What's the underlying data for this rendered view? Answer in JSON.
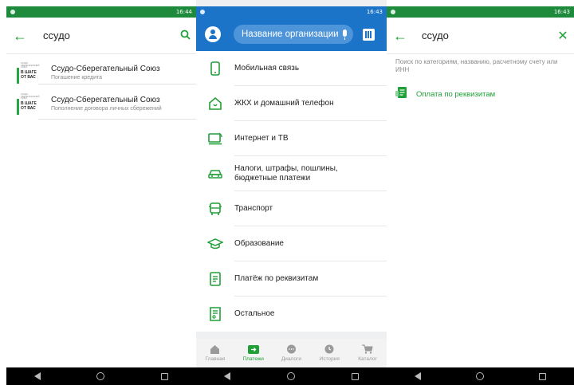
{
  "status": {
    "left_time": "16:44",
    "middle_time": "16:43",
    "right_time": "16:43"
  },
  "screen1": {
    "query": "ссудо",
    "back_icon": "arrow-left-icon",
    "search_icon": "search-icon",
    "results": [
      {
        "title": "Ссудо-Сберегательный Союз",
        "subtitle": "Погашение кредита",
        "logo_small": "ССУДО-СБЕРЕГАТЕЛЬНЫЙ СОЮЗ",
        "logo_big": "В ШАГЕ ОТ ВАС"
      },
      {
        "title": "Ссудо-Сберегательный Союз",
        "subtitle": "Пополнение договора личных сбережений",
        "logo_small": "ССУДО-СБЕРЕГАТЕЛЬНЫЙ СОЮЗ",
        "logo_big": "В ШАГЕ ОТ ВАС"
      }
    ]
  },
  "screen2": {
    "search_placeholder": "Название организации",
    "categories": [
      {
        "label": "Мобильная связь",
        "icon": "phone-icon"
      },
      {
        "label": "ЖКХ и домашний телефон",
        "icon": "house-phone-icon"
      },
      {
        "label": "Интернет и ТВ",
        "icon": "tv-icon"
      },
      {
        "label": "Налоги, штрафы, пошлины, бюджетные платежи",
        "icon": "car-icon"
      },
      {
        "label": "Транспорт",
        "icon": "bus-icon"
      },
      {
        "label": "Образование",
        "icon": "graduation-cap-icon"
      },
      {
        "label": "Платёж по реквизитам",
        "icon": "document-icon"
      },
      {
        "label": "Остальное",
        "icon": "receipt-icon"
      }
    ],
    "tabs": [
      {
        "label": "Главная",
        "icon": "home-icon",
        "active": false
      },
      {
        "label": "Платежи",
        "icon": "transfer-icon",
        "active": true
      },
      {
        "label": "Диалоги",
        "icon": "chat-icon",
        "active": false
      },
      {
        "label": "История",
        "icon": "clock-icon",
        "active": false
      },
      {
        "label": "Каталог",
        "icon": "cart-icon",
        "active": false
      }
    ]
  },
  "screen3": {
    "query": "ссудо",
    "hint": "Поиск по категориям, названию, расчетному счету или ИНН",
    "requisites_label": "Оплата по реквизитам",
    "clear_icon": "close-icon"
  },
  "colors": {
    "brand_green": "#21a038",
    "statusbar_green": "#1e8a3c",
    "header_blue": "#1c74c9"
  }
}
